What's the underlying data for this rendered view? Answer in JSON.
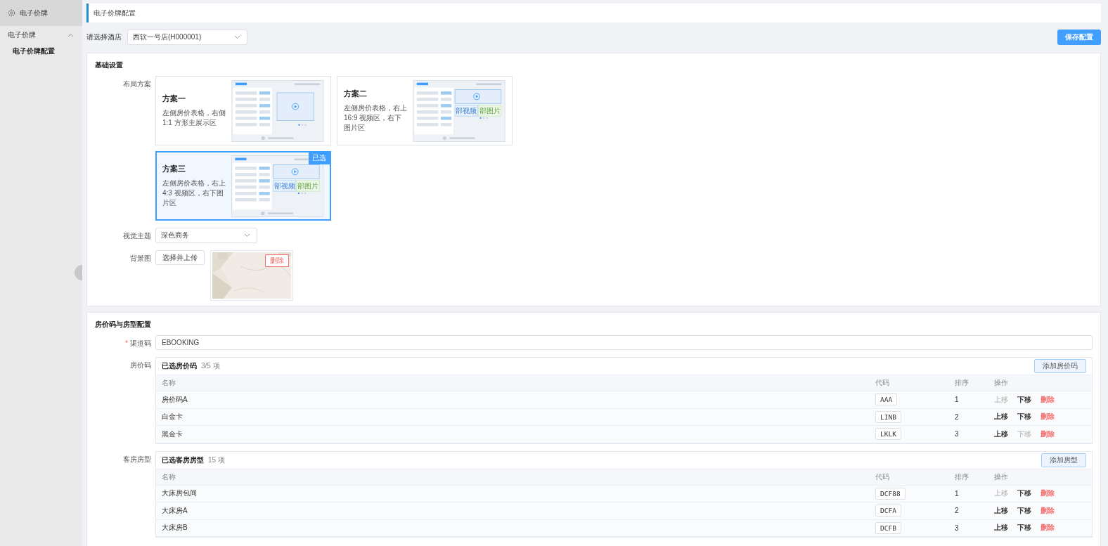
{
  "sidebar": {
    "title": "电子价牌",
    "groups": [
      {
        "label": "电子价牌",
        "expanded": true,
        "children": [
          {
            "label": "电子价牌配置",
            "selected": true
          }
        ]
      }
    ]
  },
  "header": {
    "title": "电子价牌配置"
  },
  "hotel": {
    "label": "请选择酒店",
    "value": "西软一号店(H000001)"
  },
  "save_button": "保存配置",
  "basic": {
    "title": "基础设置",
    "layout_label": "布局方案",
    "selected_badge": "已选",
    "layouts": [
      {
        "name": "方案一",
        "description": "左侧房价表格，右侧 1:1 方形主展示区",
        "kind": "square",
        "selected": false
      },
      {
        "name": "方案二",
        "description": "左侧房价表格，右上 16:9 视频区，右下图片区",
        "kind": "split",
        "video_label": "部视频",
        "image_label": "部图片",
        "selected": false
      },
      {
        "name": "方案三",
        "description": "左侧房价表格，右上 4:3 视频区，右下图片区",
        "kind": "split",
        "video_label": "部视频",
        "image_label": "部图片",
        "selected": true
      }
    ],
    "theme_label": "视觉主题",
    "theme_value": "深色商务",
    "background_label": "背景图",
    "upload_button": "选择并上传",
    "delete_button": "删除"
  },
  "pricing": {
    "title": "房价码与房型配置",
    "channel": {
      "label": "渠道码",
      "required": true,
      "required_mark": "*",
      "value": "EBOOKING"
    },
    "tables": [
      {
        "label": "房价码",
        "title": "已选房价码",
        "count": "3/5 项",
        "add_button": "添加房价码",
        "columns": [
          "名称",
          "代码",
          "排序",
          "操作"
        ],
        "rows": [
          {
            "name": "房价码A",
            "code": "AAA",
            "order": "1",
            "up": "上移",
            "up_disabled": true,
            "down": "下移",
            "down_disabled": false,
            "delete": "删除"
          },
          {
            "name": "白金卡",
            "code": "LINB",
            "order": "2",
            "up": "上移",
            "up_disabled": false,
            "down": "下移",
            "down_disabled": false,
            "delete": "删除"
          },
          {
            "name": "黑金卡",
            "code": "LKLK",
            "order": "3",
            "up": "上移",
            "up_disabled": false,
            "down": "下移",
            "down_disabled": true,
            "delete": "删除"
          }
        ]
      },
      {
        "label": "客房房型",
        "title": "已选客房房型",
        "count": "15 项",
        "add_button": "添加房型",
        "columns": [
          "名称",
          "代码",
          "排序",
          "操作"
        ],
        "rows": [
          {
            "name": "大床房包间",
            "code": "DCF88",
            "order": "1",
            "up": "上移",
            "up_disabled": true,
            "down": "下移",
            "down_disabled": false,
            "delete": "删除"
          },
          {
            "name": "大床房A",
            "code": "DCFA",
            "order": "2",
            "up": "上移",
            "up_disabled": false,
            "down": "下移",
            "down_disabled": false,
            "delete": "删除"
          },
          {
            "name": "大床房B",
            "code": "DCFB",
            "order": "3",
            "up": "上移",
            "up_disabled": false,
            "down": "下移",
            "down_disabled": false,
            "delete": "删除"
          }
        ]
      }
    ]
  }
}
